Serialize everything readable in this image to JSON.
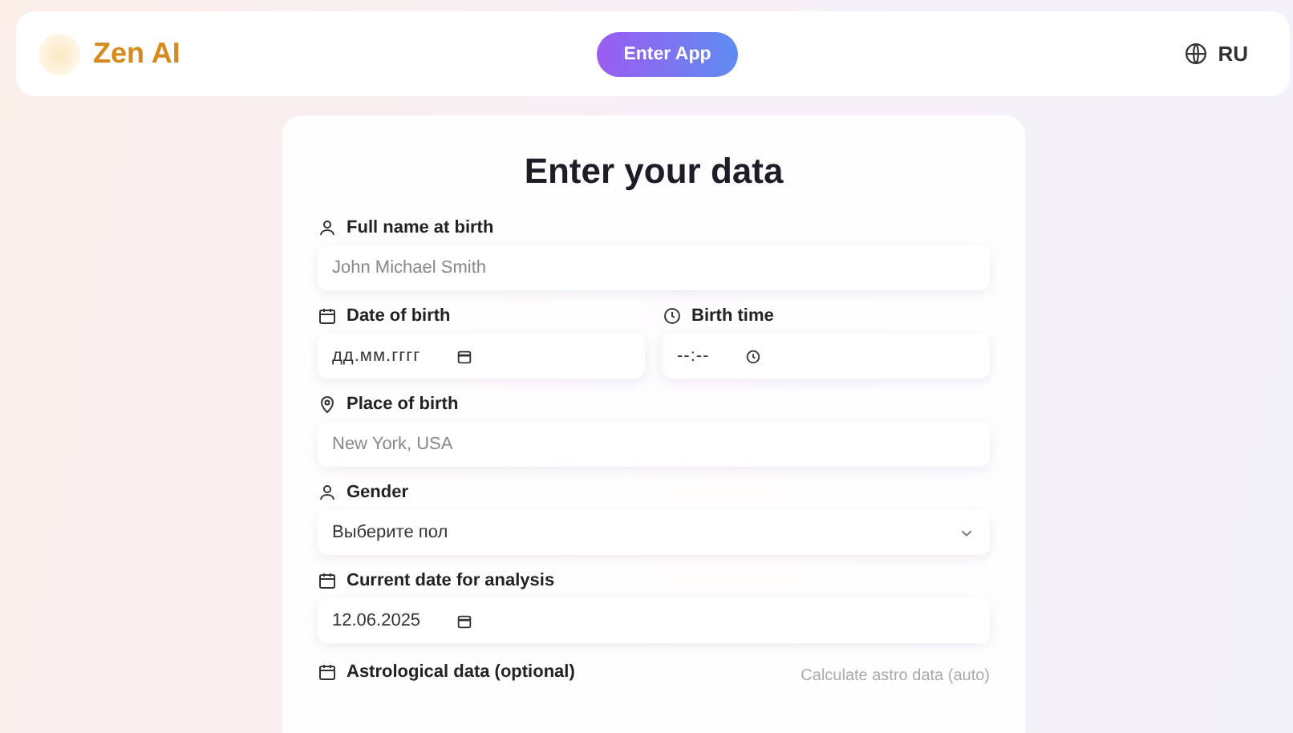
{
  "header": {
    "logo_text": "Zen AI",
    "enter_button": "Enter App",
    "language": "RU"
  },
  "form": {
    "title": "Enter your data",
    "rows": [
      {
        "fields": [
          {
            "kind": "text",
            "label": "Full name at birth",
            "placeholder": "John Michael Smith"
          }
        ]
      },
      {
        "fields": [
          {
            "kind": "date",
            "label": "Date of birth",
            "placeholder": "дд.мм.гггг"
          },
          {
            "kind": "time",
            "label": "Birth time",
            "placeholder": "--:--"
          }
        ]
      },
      {
        "fields": [
          {
            "kind": "text",
            "label": "Place of birth",
            "placeholder": "New York, USA"
          }
        ]
      },
      {
        "fields": [
          {
            "kind": "select",
            "label": "Gender",
            "value": "Выберите пол"
          }
        ]
      },
      {
        "fields": [
          {
            "kind": "date",
            "label": "Current date for analysis",
            "value": "12.06.2025"
          }
        ]
      }
    ],
    "astro": {
      "label": "Astrological data (optional)",
      "link": "Calculate astro data (auto)"
    }
  }
}
